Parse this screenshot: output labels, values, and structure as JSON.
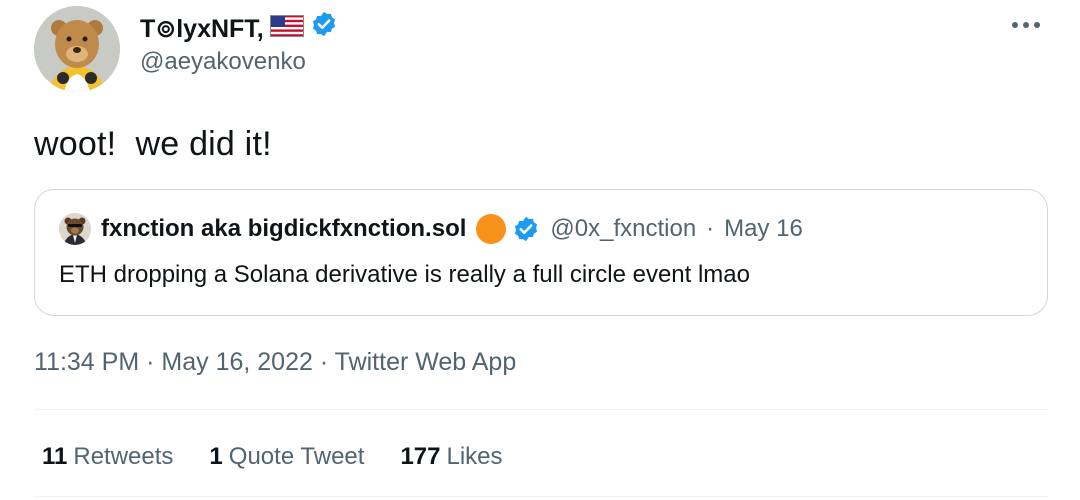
{
  "author": {
    "display_name": "T⊚lyxNFT,",
    "flag_icon": "us-flag-icon",
    "verified_icon": "verified-badge-icon",
    "handle": "@aeyakovenko"
  },
  "tweet": {
    "text": "woot!  we did it!"
  },
  "quote": {
    "name": "fxnction aka bigdickfxnction.sol",
    "handle": "@0x_fxnction",
    "separator": "·",
    "date": "May 16",
    "text": "ETH dropping a Solana derivative is really a full circle event lmao",
    "badge_color": "#f7931a"
  },
  "meta": {
    "time": "11:34 PM",
    "date": "May 16, 2022",
    "source": "Twitter Web App",
    "separator": "·"
  },
  "stats": {
    "retweets_count": "11",
    "retweets_label": "Retweets",
    "quotes_count": "1",
    "quotes_label": "Quote Tweet",
    "likes_count": "177",
    "likes_label": "Likes"
  },
  "colors": {
    "text": "#0f1419",
    "secondary": "#536471",
    "verified": "#1d9bf0",
    "border": "#cfd9de"
  }
}
